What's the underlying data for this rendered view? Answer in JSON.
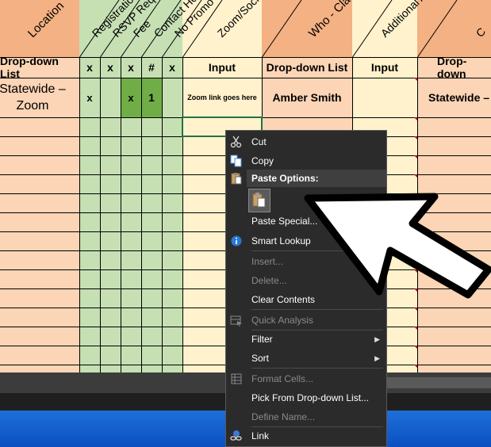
{
  "columns": {
    "location": {
      "header": "Location",
      "sub": "Drop-down List",
      "row1": "Statewide – Zoom"
    },
    "registration": {
      "header": "Registration",
      "sub": "x",
      "row1": "x"
    },
    "rsvp": {
      "header": "RSVP Required",
      "sub": "x",
      "row1": ""
    },
    "fee": {
      "header": "Fee",
      "sub": "x",
      "row1": "x"
    },
    "contact": {
      "header": "Contact Hours",
      "sub": "#",
      "row1": "1"
    },
    "nopromo": {
      "header": "No Promo",
      "sub": "x",
      "row1": ""
    },
    "zoom": {
      "header": "Zoom/Social Link/Telecon",
      "sub": "Input",
      "row1": "Zoom link goes here"
    },
    "who": {
      "header": "Who - Class",
      "sub": "Drop-down List",
      "row1": "Amber Smith"
    },
    "additional": {
      "header": "Additional Add to Prom",
      "sub": "Input",
      "row1": ""
    },
    "last": {
      "header": "C",
      "sub": "Drop-down",
      "row1": "Statewide –"
    }
  },
  "context_menu": {
    "cut": "Cut",
    "copy": "Copy",
    "paste_options": "Paste Options:",
    "paste_special": "Paste Special...",
    "smart_lookup": "Smart Lookup",
    "insert": "Insert...",
    "delete": "Delete...",
    "clear_contents": "Clear Contents",
    "quick_analysis": "Quick Analysis",
    "filter": "Filter",
    "sort": "Sort",
    "format_cells": "Format Cells...",
    "pick_from_list": "Pick From Drop-down List...",
    "define_name": "Define Name...",
    "link": "Link"
  },
  "icons": {
    "cut": "scissors-icon",
    "copy": "copy-icon",
    "paste": "clipboard-icon",
    "smart_lookup": "info-icon",
    "quick_analysis": "quick-analysis-icon",
    "format_cells": "format-cells-icon",
    "link": "link-icon",
    "pointer": "arrow-pointer-icon"
  },
  "colors": {
    "peach": "#fbd5b5",
    "header_peach": "#f4b183",
    "yellow": "#fff2cc",
    "green": "#c6e0b4",
    "dark_green": "#70ad47",
    "menu_bg": "#2b2b2b"
  }
}
